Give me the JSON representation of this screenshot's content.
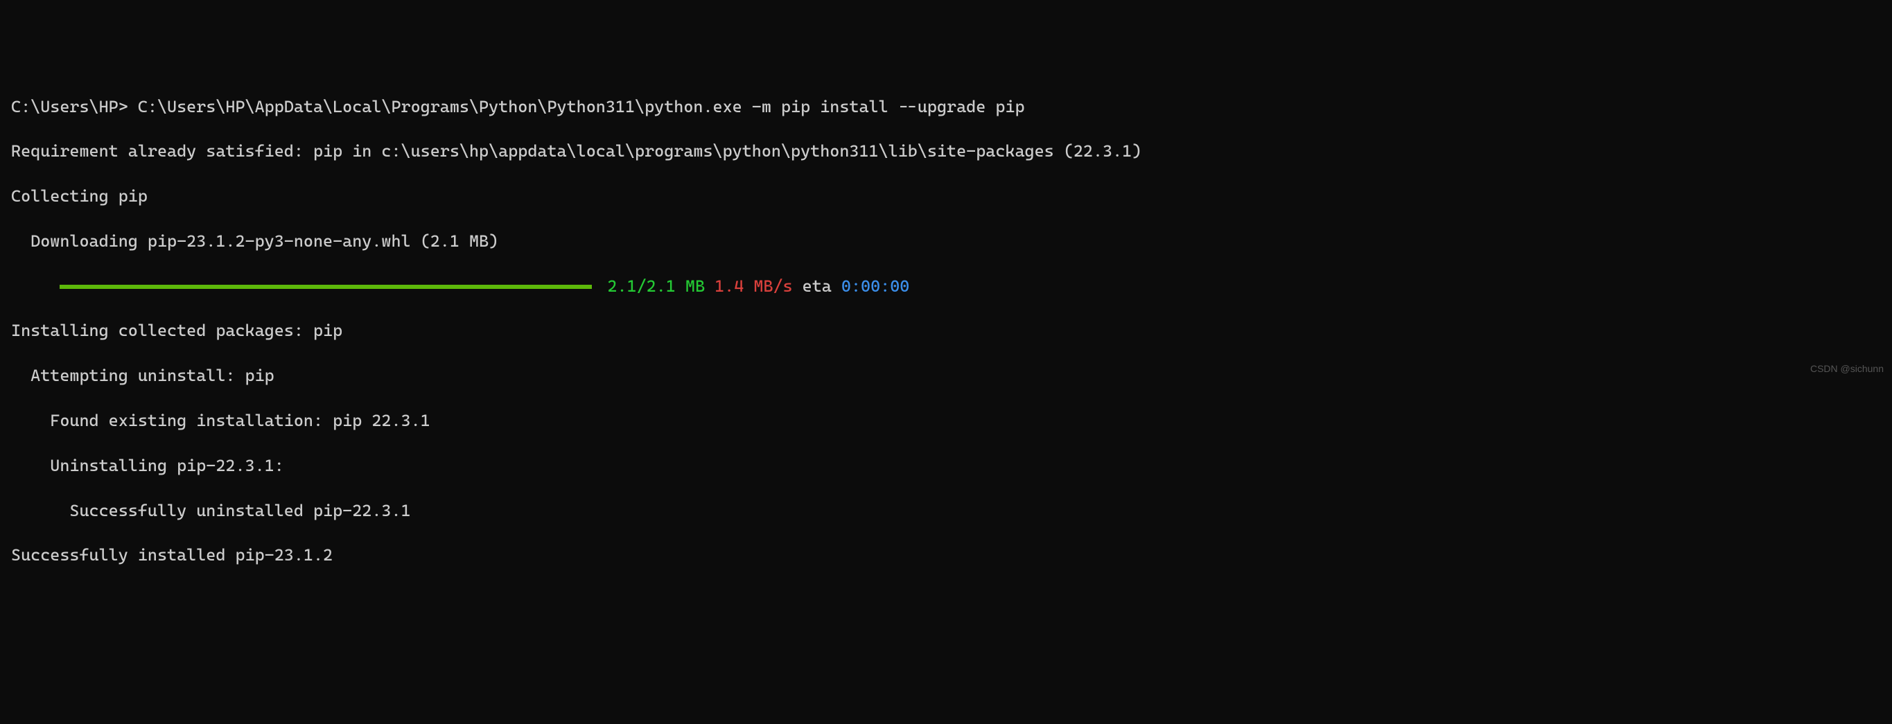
{
  "prompt": "C:\\Users\\HP> ",
  "command": "C:\\Users\\HP\\AppData\\Local\\Programs\\Python\\Python311\\python.exe -m pip install --upgrade pip",
  "lines": {
    "req_satisfied": "Requirement already satisfied: pip in c:\\users\\hp\\appdata\\local\\programs\\python\\python311\\lib\\site-packages (22.3.1)",
    "collecting": "Collecting pip",
    "downloading": "  Downloading pip-23.1.2-py3-none-any.whl (2.1 MB)",
    "installing": "Installing collected packages: pip",
    "attempting": "  Attempting uninstall: pip",
    "found_existing": "    Found existing installation: pip 22.3.1",
    "uninstalling": "    Uninstalling pip-22.3.1:",
    "uninstalled": "      Successfully uninstalled pip-22.3.1",
    "success": "Successfully installed pip-23.1.2"
  },
  "progress": {
    "size": "2.1/2.1 MB",
    "speed": "1.4 MB/s",
    "eta_label": "eta",
    "eta_time": "0:00:00"
  },
  "watermark": "CSDN @sichunn"
}
